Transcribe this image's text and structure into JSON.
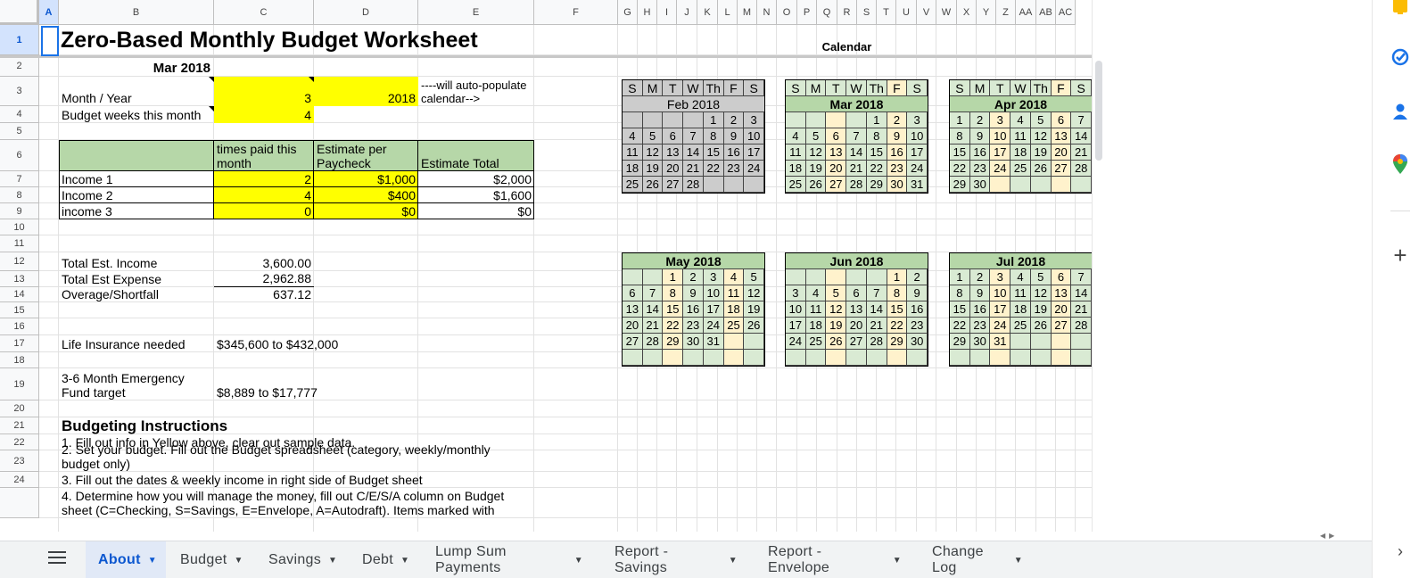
{
  "columns": [
    "A",
    "B",
    "C",
    "D",
    "E",
    "F",
    "G",
    "H",
    "I",
    "J",
    "K",
    "L",
    "M",
    "N",
    "O",
    "P",
    "Q",
    "R",
    "S",
    "T",
    "U",
    "V",
    "W",
    "X",
    "Y",
    "Z",
    "AA",
    "AB",
    "AC"
  ],
  "rows": [
    "1",
    "2",
    "3",
    "4",
    "5",
    "6",
    "7",
    "8",
    "9",
    "10",
    "11",
    "12",
    "13",
    "14",
    "15",
    "16",
    "17",
    "18",
    "19",
    "20",
    "21",
    "22",
    "23",
    "24",
    ""
  ],
  "sheet": {
    "title": "Zero-Based Monthly Budget Worksheet",
    "calendar_label": "Calendar",
    "month_label": "Mar 2018",
    "month_year_label": "Month / Year",
    "month_value": "3",
    "year_value": "2018",
    "autopop_note": "----will auto-populate calendar-->",
    "budget_weeks_label": "Budget weeks this month",
    "budget_weeks_value": "4",
    "tbl_hdr_times": "times paid this month",
    "tbl_hdr_estimate": "Estimate per Paycheck",
    "tbl_hdr_total": "Estimate Total",
    "incomes": [
      {
        "name": "Income 1",
        "times": "2",
        "est": "$1,000",
        "total": "$2,000"
      },
      {
        "name": "Income 2",
        "times": "4",
        "est": "$400",
        "total": "$1,600"
      },
      {
        "name": "income 3",
        "times": "0",
        "est": "$0",
        "total": "$0"
      }
    ],
    "total_income_label": "Total Est. Income",
    "total_income_value": "3,600.00",
    "total_expense_label": "Total Est Expense",
    "total_expense_value": "2,962.88",
    "overage_label": "Overage/Shortfall",
    "overage_value": "637.12",
    "life_ins_label": "Life Insurance needed",
    "life_ins_value": "$345,600 to $432,000",
    "emergency_label": "3-6 Month Emergency Fund target",
    "emergency_value": "$8,889 to $17,777",
    "instr_heading": "Budgeting Instructions",
    "instr_1": "1.  Fill out info in Yellow above, clear out sample data.",
    "instr_2": "2.  Set your budget.  Fill out the Budget spreadsheet (category, weekly/monthly budget only)",
    "instr_3": "3. Fill out the dates & weekly income in right side of Budget sheet",
    "instr_4": "4. Determine how you will manage the money, fill out C/E/S/A column on Budget sheet (C=Checking, S=Savings, E=Envelope, A=Autodraft).  Items marked with"
  },
  "calendar": {
    "day_headers": [
      "S",
      "M",
      "T",
      "W",
      "Th",
      "F",
      "S"
    ],
    "colors": {
      "gray": "#cccccc",
      "green": "#d9ead3",
      "green_title": "#b6d7a8",
      "yellow": "#fff2cc"
    },
    "months": [
      {
        "name": "Feb 2018",
        "style": "gray",
        "weeks": [
          [
            "",
            "",
            "",
            "",
            "1",
            "2",
            "3"
          ],
          [
            "4",
            "5",
            "6",
            "7",
            "8",
            "9",
            "10"
          ],
          [
            "11",
            "12",
            "13",
            "14",
            "15",
            "16",
            "17"
          ],
          [
            "18",
            "19",
            "20",
            "21",
            "22",
            "23",
            "24"
          ],
          [
            "25",
            "26",
            "27",
            "28",
            "",
            "",
            ""
          ]
        ]
      },
      {
        "name": "Mar 2018",
        "style": "green",
        "weeks": [
          [
            "",
            "",
            "",
            "",
            "1",
            "2",
            "3"
          ],
          [
            "4",
            "5",
            "6",
            "7",
            "8",
            "9",
            "10"
          ],
          [
            "11",
            "12",
            "13",
            "14",
            "15",
            "16",
            "17"
          ],
          [
            "18",
            "19",
            "20",
            "21",
            "22",
            "23",
            "24"
          ],
          [
            "25",
            "26",
            "27",
            "28",
            "29",
            "30",
            "31"
          ]
        ]
      },
      {
        "name": "Apr 2018",
        "style": "green",
        "weeks": [
          [
            "1",
            "2",
            "3",
            "4",
            "5",
            "6",
            "7"
          ],
          [
            "8",
            "9",
            "10",
            "11",
            "12",
            "13",
            "14"
          ],
          [
            "15",
            "16",
            "17",
            "18",
            "19",
            "20",
            "21"
          ],
          [
            "22",
            "23",
            "24",
            "25",
            "26",
            "27",
            "28"
          ],
          [
            "29",
            "30",
            "",
            "",
            "",
            "",
            ""
          ]
        ]
      },
      {
        "name": "May 2018",
        "style": "green",
        "weeks": [
          [
            "",
            "",
            "1",
            "2",
            "3",
            "4",
            "5"
          ],
          [
            "6",
            "7",
            "8",
            "9",
            "10",
            "11",
            "12"
          ],
          [
            "13",
            "14",
            "15",
            "16",
            "17",
            "18",
            "19"
          ],
          [
            "20",
            "21",
            "22",
            "23",
            "24",
            "25",
            "26"
          ],
          [
            "27",
            "28",
            "29",
            "30",
            "31",
            "",
            ""
          ],
          [
            "",
            "",
            "",
            "",
            "",
            "",
            ""
          ]
        ]
      },
      {
        "name": "Jun 2018",
        "style": "green",
        "weeks": [
          [
            "",
            "",
            "",
            "",
            "",
            "1",
            "2"
          ],
          [
            "3",
            "4",
            "5",
            "6",
            "7",
            "8",
            "9"
          ],
          [
            "10",
            "11",
            "12",
            "13",
            "14",
            "15",
            "16"
          ],
          [
            "17",
            "18",
            "19",
            "20",
            "21",
            "22",
            "23"
          ],
          [
            "24",
            "25",
            "26",
            "27",
            "28",
            "29",
            "30"
          ],
          [
            "",
            "",
            "",
            "",
            "",
            "",
            ""
          ]
        ]
      },
      {
        "name": "Jul 2018",
        "style": "green",
        "weeks": [
          [
            "1",
            "2",
            "3",
            "4",
            "5",
            "6",
            "7"
          ],
          [
            "8",
            "9",
            "10",
            "11",
            "12",
            "13",
            "14"
          ],
          [
            "15",
            "16",
            "17",
            "18",
            "19",
            "20",
            "21"
          ],
          [
            "22",
            "23",
            "24",
            "25",
            "26",
            "27",
            "28"
          ],
          [
            "29",
            "30",
            "31",
            "",
            "",
            "",
            ""
          ],
          [
            "",
            "",
            "",
            "",
            "",
            "",
            ""
          ]
        ]
      }
    ]
  },
  "tabs": [
    {
      "label": "About",
      "active": true
    },
    {
      "label": "Budget"
    },
    {
      "label": "Savings"
    },
    {
      "label": "Debt"
    },
    {
      "label": "Lump Sum Payments"
    },
    {
      "label": "Report - Savings"
    },
    {
      "label": "Report - Envelope"
    },
    {
      "label": "Change Log"
    }
  ],
  "sidebar_icons": [
    "keep-icon",
    "tasks-icon",
    "contacts-icon",
    "maps-icon",
    "add-icon",
    "expand-icon"
  ]
}
